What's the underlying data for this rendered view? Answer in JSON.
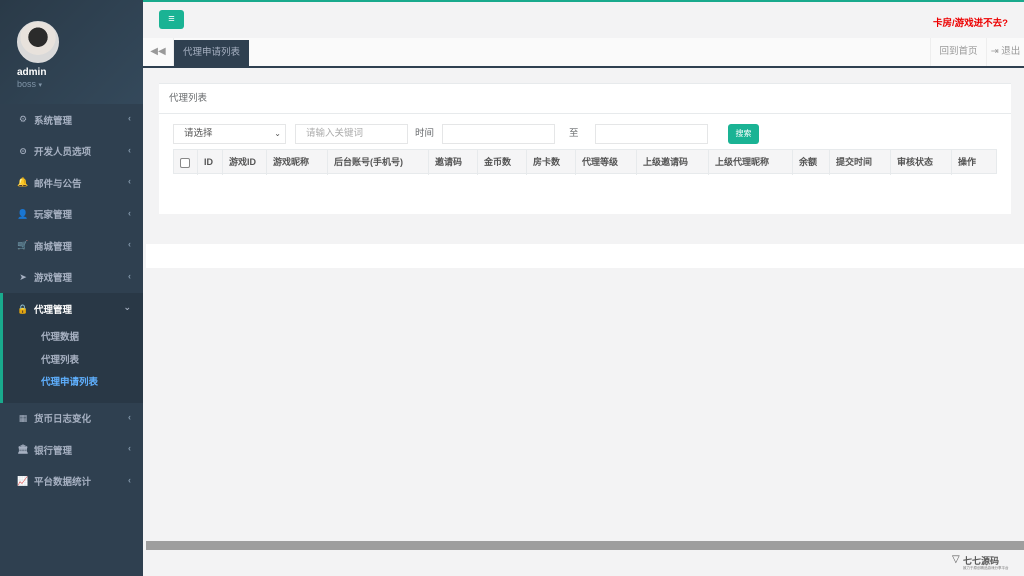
{
  "user": {
    "name": "admin",
    "role": "boss"
  },
  "sidebar": {
    "items": [
      {
        "label": "系统管理",
        "icon": "gears-icon",
        "glyph": "⚙"
      },
      {
        "label": "开发人员选项",
        "icon": "gamepad-icon",
        "glyph": "⊝"
      },
      {
        "label": "邮件与公告",
        "icon": "bell-icon",
        "glyph": "🔔"
      },
      {
        "label": "玩家管理",
        "icon": "user-icon",
        "glyph": "👤"
      },
      {
        "label": "商城管理",
        "icon": "cart-icon",
        "glyph": "🛒"
      },
      {
        "label": "游戏管理",
        "icon": "rocket-icon",
        "glyph": "➤"
      },
      {
        "label": "代理管理",
        "icon": "lock-icon",
        "glyph": "🔒"
      },
      {
        "label": "货币日志变化",
        "icon": "calendar-icon",
        "glyph": "▦"
      },
      {
        "label": "银行管理",
        "icon": "bank-icon",
        "glyph": "🏛"
      },
      {
        "label": "平台数据统计",
        "icon": "line-chart-icon",
        "glyph": "📈"
      }
    ],
    "submenu": [
      "代理数据",
      "代理列表",
      "代理申请列表"
    ]
  },
  "topbar": {
    "help_text": "卡房/游戏进不去?"
  },
  "tabs": {
    "active": "代理申请列表",
    "home": "回到首页",
    "logout": "退出"
  },
  "panel": {
    "title": "代理列表"
  },
  "filters": {
    "select_value": "请选择",
    "keyword_placeholder": "请输入关键词",
    "time_label": "时间",
    "to_label": "至",
    "search_label": "搜索"
  },
  "table": {
    "columns": [
      "ID",
      "游戏ID",
      "游戏昵称",
      "后台账号(手机号)",
      "邀请码",
      "金币数",
      "房卡数",
      "代理等级",
      "上级邀请码",
      "上级代理昵称",
      "余额",
      "提交时间",
      "审核状态",
      "操作"
    ]
  },
  "watermark": {
    "text": "七七源码",
    "sub": "致力于原创精品游戏分享平台"
  }
}
